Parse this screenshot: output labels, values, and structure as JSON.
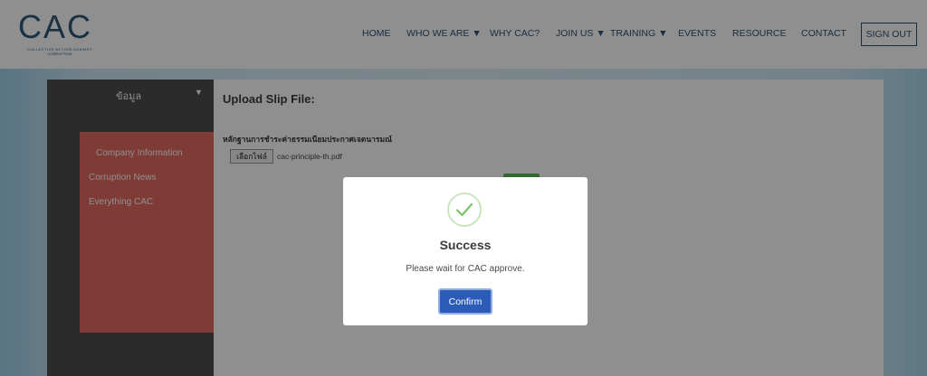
{
  "logo": {
    "mark": "CAC",
    "tagline": "COLLECTIVE ACTION AGAINST",
    "subline": "CORRUPTION"
  },
  "nav": {
    "items": [
      "HOME",
      "WHO WE ARE ▼",
      "WHY CAC?",
      "JOIN US ▼",
      "TRAINING ▼",
      "EVENTS",
      "RESOURCE",
      "CONTACT"
    ],
    "signout_label": "SIGN OUT"
  },
  "sidebar": {
    "title": "ข้อมูล",
    "caret": "▼",
    "items": [
      "Company Information",
      "Corruption News",
      "Everything CAC"
    ]
  },
  "content": {
    "upload_title": "Upload Slip File:",
    "slip_label": "หลักฐานการชำระค่าธรรมเนียมประกาศเจตนารมณ์",
    "file_button_label": "เลือกไฟล์",
    "file_name": "cac-principle-th.pdf"
  },
  "modal": {
    "title": "Success",
    "message": "Please wait for CAC approve.",
    "confirm_label": "Confirm"
  },
  "colors": {
    "brand": "#2a5375",
    "accent_menu": "#e36b60",
    "confirm_button": "#2d5cb8",
    "success_check": "#7cc46a"
  }
}
